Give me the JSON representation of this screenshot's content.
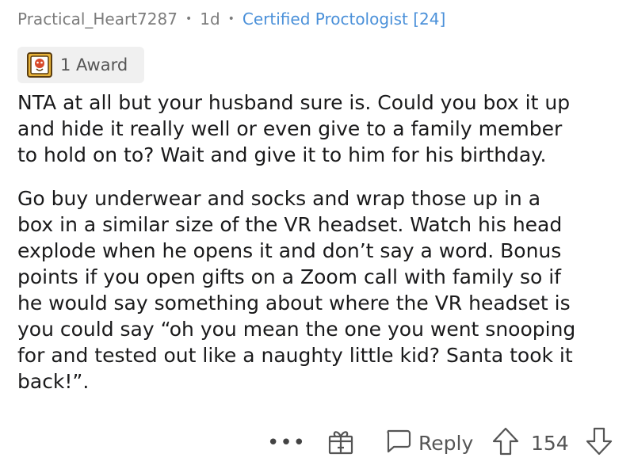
{
  "comment": {
    "author": "Practical_Heart7287",
    "age": "1d",
    "flair": "Certified Proctologist [24]",
    "award_label": "1 Award",
    "paragraphs": [
      "NTA at all but your husband sure is. Could you box it up\nand hide it really well or even give to a family member\nto hold on to? Wait and give it to him for his birthday.",
      "Go buy underwear and socks and wrap those up in a\nbox in a similar size of the VR headset. Watch his head\nexplode when he opens it and don’t say a word. Bonus\npoints if you open gifts on a Zoom call with family so if\nhe would say something about where the VR headset is\nyou could say “oh you mean the one you went snooping\nfor and tested out like a naughty little kid? Santa took it\nback!”."
    ]
  },
  "actions": {
    "more": "•••",
    "reply_label": "Reply",
    "score": "154"
  },
  "icons": {
    "award": "award-icon",
    "gift": "gift-icon",
    "reply": "speech-bubble-icon",
    "upvote": "arrow-up-icon",
    "downvote": "arrow-down-icon"
  },
  "colors": {
    "flair": "#4a90d9",
    "meta": "#7c7c7c",
    "award_bg": "#f0f0f0"
  }
}
